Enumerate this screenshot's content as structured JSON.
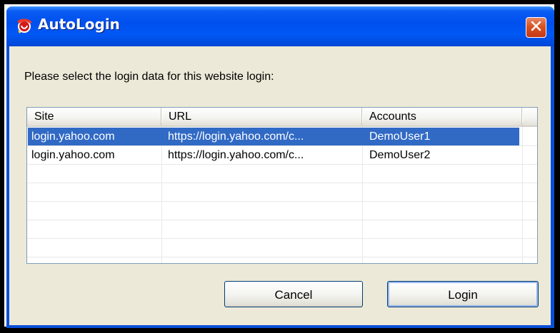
{
  "window": {
    "title": "AutoLogin",
    "app_icon": "autologin-icon",
    "close_icon": "close-icon"
  },
  "prompt": "Please select the login data for this website login:",
  "list": {
    "columns": [
      "Site",
      "URL",
      "Accounts"
    ],
    "rows": [
      {
        "site": "login.yahoo.com",
        "url": "https://login.yahoo.com/c...",
        "account": "DemoUser1",
        "selected": true
      },
      {
        "site": "login.yahoo.com",
        "url": "https://login.yahoo.com/c...",
        "account": "DemoUser2",
        "selected": false
      }
    ]
  },
  "buttons": {
    "cancel": "Cancel",
    "login": "Login"
  },
  "colors": {
    "titlebar": "#0054e3",
    "close": "#d9531f",
    "selection": "#316ac5",
    "client": "#ece9d8"
  }
}
